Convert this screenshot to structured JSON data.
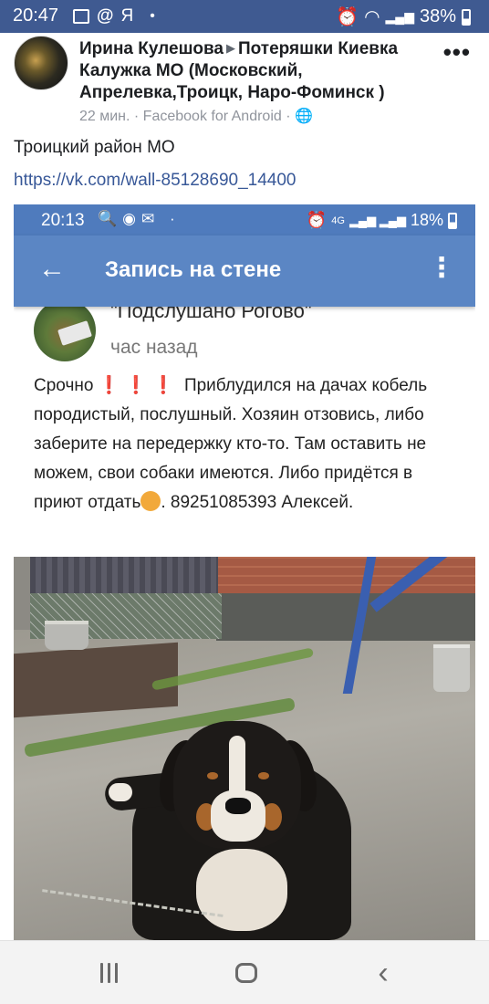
{
  "status_bar": {
    "time": "20:47",
    "app_letter": "Я",
    "battery_percent": "38%"
  },
  "post": {
    "author": "Ирина Кулешова",
    "group": "Потеряшки Киевка Калужка МО (Московский, Апрелевка,Троицк, Наро-Фоминск )",
    "meta": "22 мин. · Facebook for Android ·",
    "more_label": "•••",
    "text": "Троицкий район МО",
    "link": "https://vk.com/wall-85128690_14400"
  },
  "shared_screenshot": {
    "status_time": "20:13",
    "network_label": "4G",
    "battery_percent": "18%",
    "title": "Запись на стене",
    "group_name": "\"Подслушано Рогово\"",
    "time_ago": "час назад",
    "text_start": "Срочно",
    "exclamations": "❗❗❗",
    "text_main": " Приблудился на дачах кобель породистый, послушный. Хозяин отзовись, либо заберите на передержку кто-то. Там оставить не можем, свои собаки имеются. Либо придётся в приют отдать",
    "text_end": ". 89251085393 Алексей."
  },
  "icons": {
    "back": "arrow-left-icon",
    "menu": "kebab-menu-icon",
    "globe": "globe-icon"
  },
  "colors": {
    "facebook_status_bar": "#3f5a91",
    "vk_app_bar": "#5b86c4",
    "link": "#385898"
  }
}
